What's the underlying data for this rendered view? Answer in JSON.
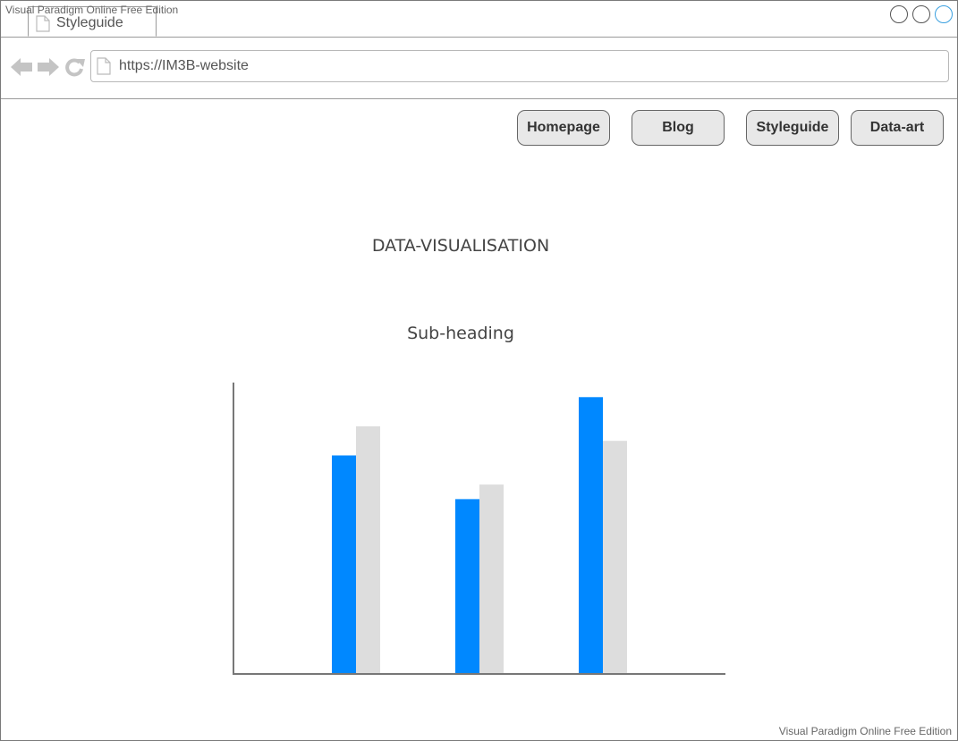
{
  "watermark": "Visual Paradigm Online Free Edition",
  "browser": {
    "tab_label": "Styleguide",
    "url": "https://IM3B-website",
    "icons": [
      "back-arrow-icon",
      "forward-arrow-icon",
      "reload-icon",
      "document-icon"
    ]
  },
  "nav": {
    "homepage": "Homepage",
    "blog": "Blog",
    "styleguide": "Styleguide",
    "data_art": "Data-art"
  },
  "page": {
    "title": "DATA-VISUALISATION",
    "subtitle": "Sub-heading"
  },
  "colors": {
    "series_a": "#0088ff",
    "series_b": "#dddddd",
    "axis": "#777777"
  },
  "chart_data": {
    "type": "bar",
    "categories": [
      "",
      "",
      ""
    ],
    "series": [
      {
        "values": [
          75,
          60,
          95
        ]
      },
      {
        "values": [
          85,
          65,
          80
        ]
      }
    ],
    "ylim": [
      0,
      100
    ],
    "xlabel": "",
    "ylabel": "",
    "grid": false,
    "legend": "none"
  }
}
